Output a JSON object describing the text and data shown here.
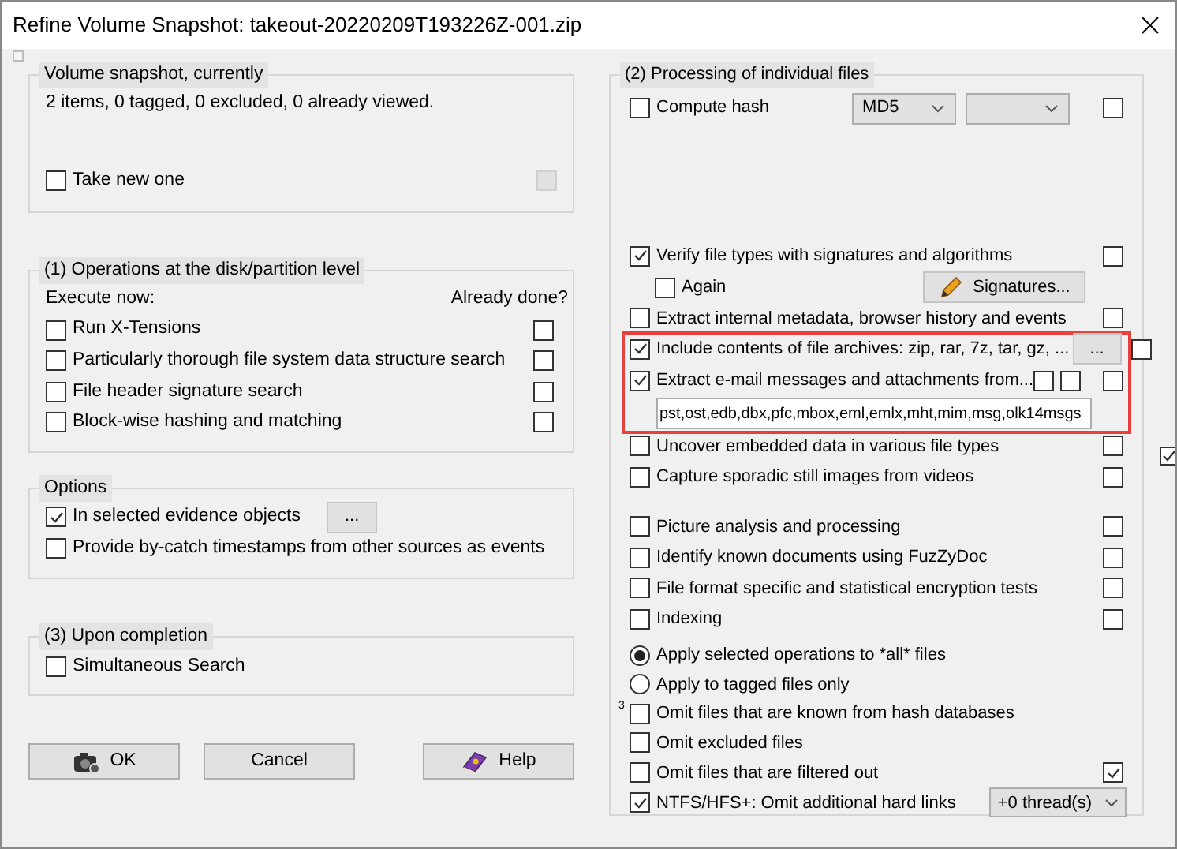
{
  "window": {
    "title": "Refine Volume Snapshot: takeout-20220209T193226Z-001.zip"
  },
  "snapshot": {
    "title": "Volume snapshot, currently",
    "summary": "2 items, 0 tagged, 0 excluded, 0 already viewed.",
    "take_new": {
      "label": "Take new one",
      "checked": false
    }
  },
  "disk_ops": {
    "title": "(1) Operations at the disk/partition level",
    "execute_header": "Execute now:",
    "done_header": "Already done?",
    "items": [
      {
        "label": "Run X-Tensions",
        "checked": false,
        "done": false
      },
      {
        "label": "Particularly thorough file system data structure search",
        "checked": false,
        "done": false
      },
      {
        "label": "File header signature search",
        "checked": false,
        "done": false
      },
      {
        "label": "Block-wise hashing and matching",
        "checked": false,
        "done": false
      }
    ]
  },
  "options": {
    "title": "Options",
    "items": [
      {
        "label": "In selected evidence objects",
        "checked": true,
        "button": "..."
      },
      {
        "label": "Provide by-catch timestamps from other sources as events",
        "checked": false
      }
    ]
  },
  "completion": {
    "title": "(3) Upon completion",
    "items": [
      {
        "label": "Simultaneous Search",
        "checked": false
      }
    ]
  },
  "buttons": [
    {
      "label": "OK",
      "kind": "ok"
    },
    {
      "label": "Cancel",
      "kind": "cancel"
    },
    {
      "label": "Help",
      "kind": "help"
    }
  ],
  "processing": {
    "title": "(2) Processing of individual files",
    "blocks": [
      {
        "highlighted": false,
        "rows": [
          {
            "kind": "hash",
            "label": "Compute hash",
            "checked": false,
            "algorithm": "MD5",
            "done": false
          }
        ]
      },
      {
        "highlighted": false,
        "rows": [
          {
            "kind": "check",
            "label": "Verify file types with signatures and algorithms",
            "checked": true,
            "done": false
          },
          {
            "kind": "again",
            "label": "Again",
            "checked": false,
            "button": "Signatures..."
          },
          {
            "kind": "check",
            "label": "Extract internal metadata, browser history and events",
            "checked": false,
            "done": false
          }
        ]
      },
      {
        "highlighted": true,
        "rows": [
          {
            "kind": "check",
            "label": "Include contents of file archives: zip, rar, 7z, tar, gz, ...",
            "checked": true,
            "button": "...",
            "done": false
          },
          {
            "kind": "email",
            "label": "Extract e-mail messages and attachments from...",
            "checked": true,
            "option_a": false,
            "option_b": false,
            "done": false,
            "value": "pst,ost,edb,dbx,pfc,mbox,eml,emlx,mht,mim,msg,olk14msgs"
          }
        ]
      },
      {
        "highlighted": false,
        "rows": [
          {
            "kind": "check",
            "label": "Uncover embedded data in various file types",
            "checked": false,
            "done": false
          },
          {
            "kind": "check",
            "label": "Capture sporadic still images from videos",
            "checked": false,
            "done": false
          }
        ]
      },
      {
        "highlighted": false,
        "rows": [
          {
            "kind": "check",
            "label": "Picture analysis and processing",
            "checked": false,
            "done": false
          },
          {
            "kind": "check",
            "label": "Identify known documents using FuzZyDoc",
            "checked": false,
            "done": false
          },
          {
            "kind": "check",
            "label": "File format specific and statistical encryption tests",
            "checked": false,
            "done": false
          },
          {
            "kind": "check",
            "label": "Indexing",
            "checked": false,
            "done": false
          }
        ]
      },
      {
        "highlighted": false,
        "rows": [
          {
            "kind": "radio",
            "label": "Apply selected operations to *all* files",
            "selected": true
          },
          {
            "kind": "radio",
            "label": "Apply to tagged files only",
            "selected": false
          },
          {
            "kind": "check",
            "label": "Omit files that are known from hash databases",
            "checked": false,
            "note": "3"
          },
          {
            "kind": "check",
            "label": "Omit excluded files",
            "checked": false
          },
          {
            "kind": "check",
            "label": "Omit files that are filtered out",
            "checked": false,
            "done": true
          },
          {
            "kind": "check",
            "label": "NTFS/HFS+: Omit additional hard links",
            "checked": true,
            "threads": "+0 thread(s)"
          }
        ]
      }
    ]
  },
  "side_toggle": {
    "checked": true
  }
}
